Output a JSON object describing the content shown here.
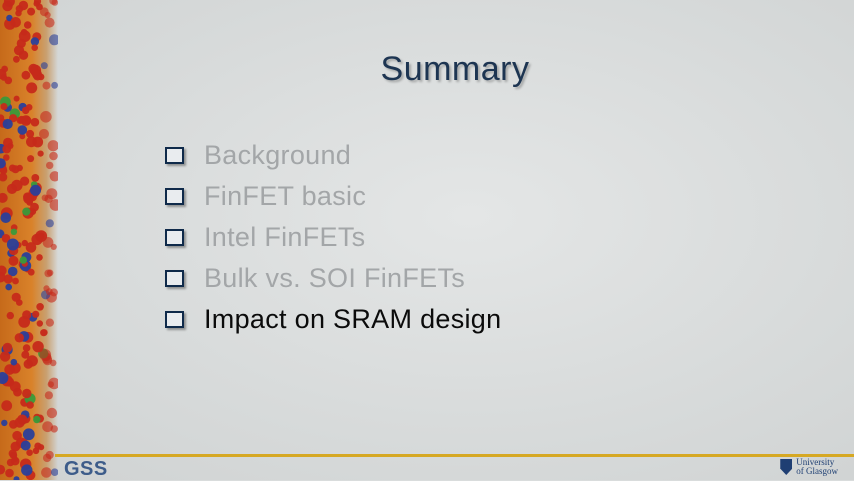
{
  "slide": {
    "title": "Summary",
    "items": [
      {
        "label": "Background",
        "active": false
      },
      {
        "label": "FinFET basic",
        "active": false
      },
      {
        "label": "Intel FinFETs",
        "active": false
      },
      {
        "label": "Bulk vs. SOI FinFETs",
        "active": false
      },
      {
        "label": "Impact on SRAM design",
        "active": true
      }
    ]
  },
  "footer": {
    "left_logo": "GSS",
    "right_logo_line1": "University",
    "right_logo_line2": "of Glasgow"
  },
  "colors": {
    "title": "#1d3552",
    "inactive_item": "#a3a6a8",
    "active_item": "#0b0b0b",
    "footer_line": "#d6a823",
    "strip_base": "#c66a1a",
    "atom_red": "#c62a1a",
    "atom_blue": "#2a3f9a",
    "atom_green": "#3a9a3a"
  }
}
